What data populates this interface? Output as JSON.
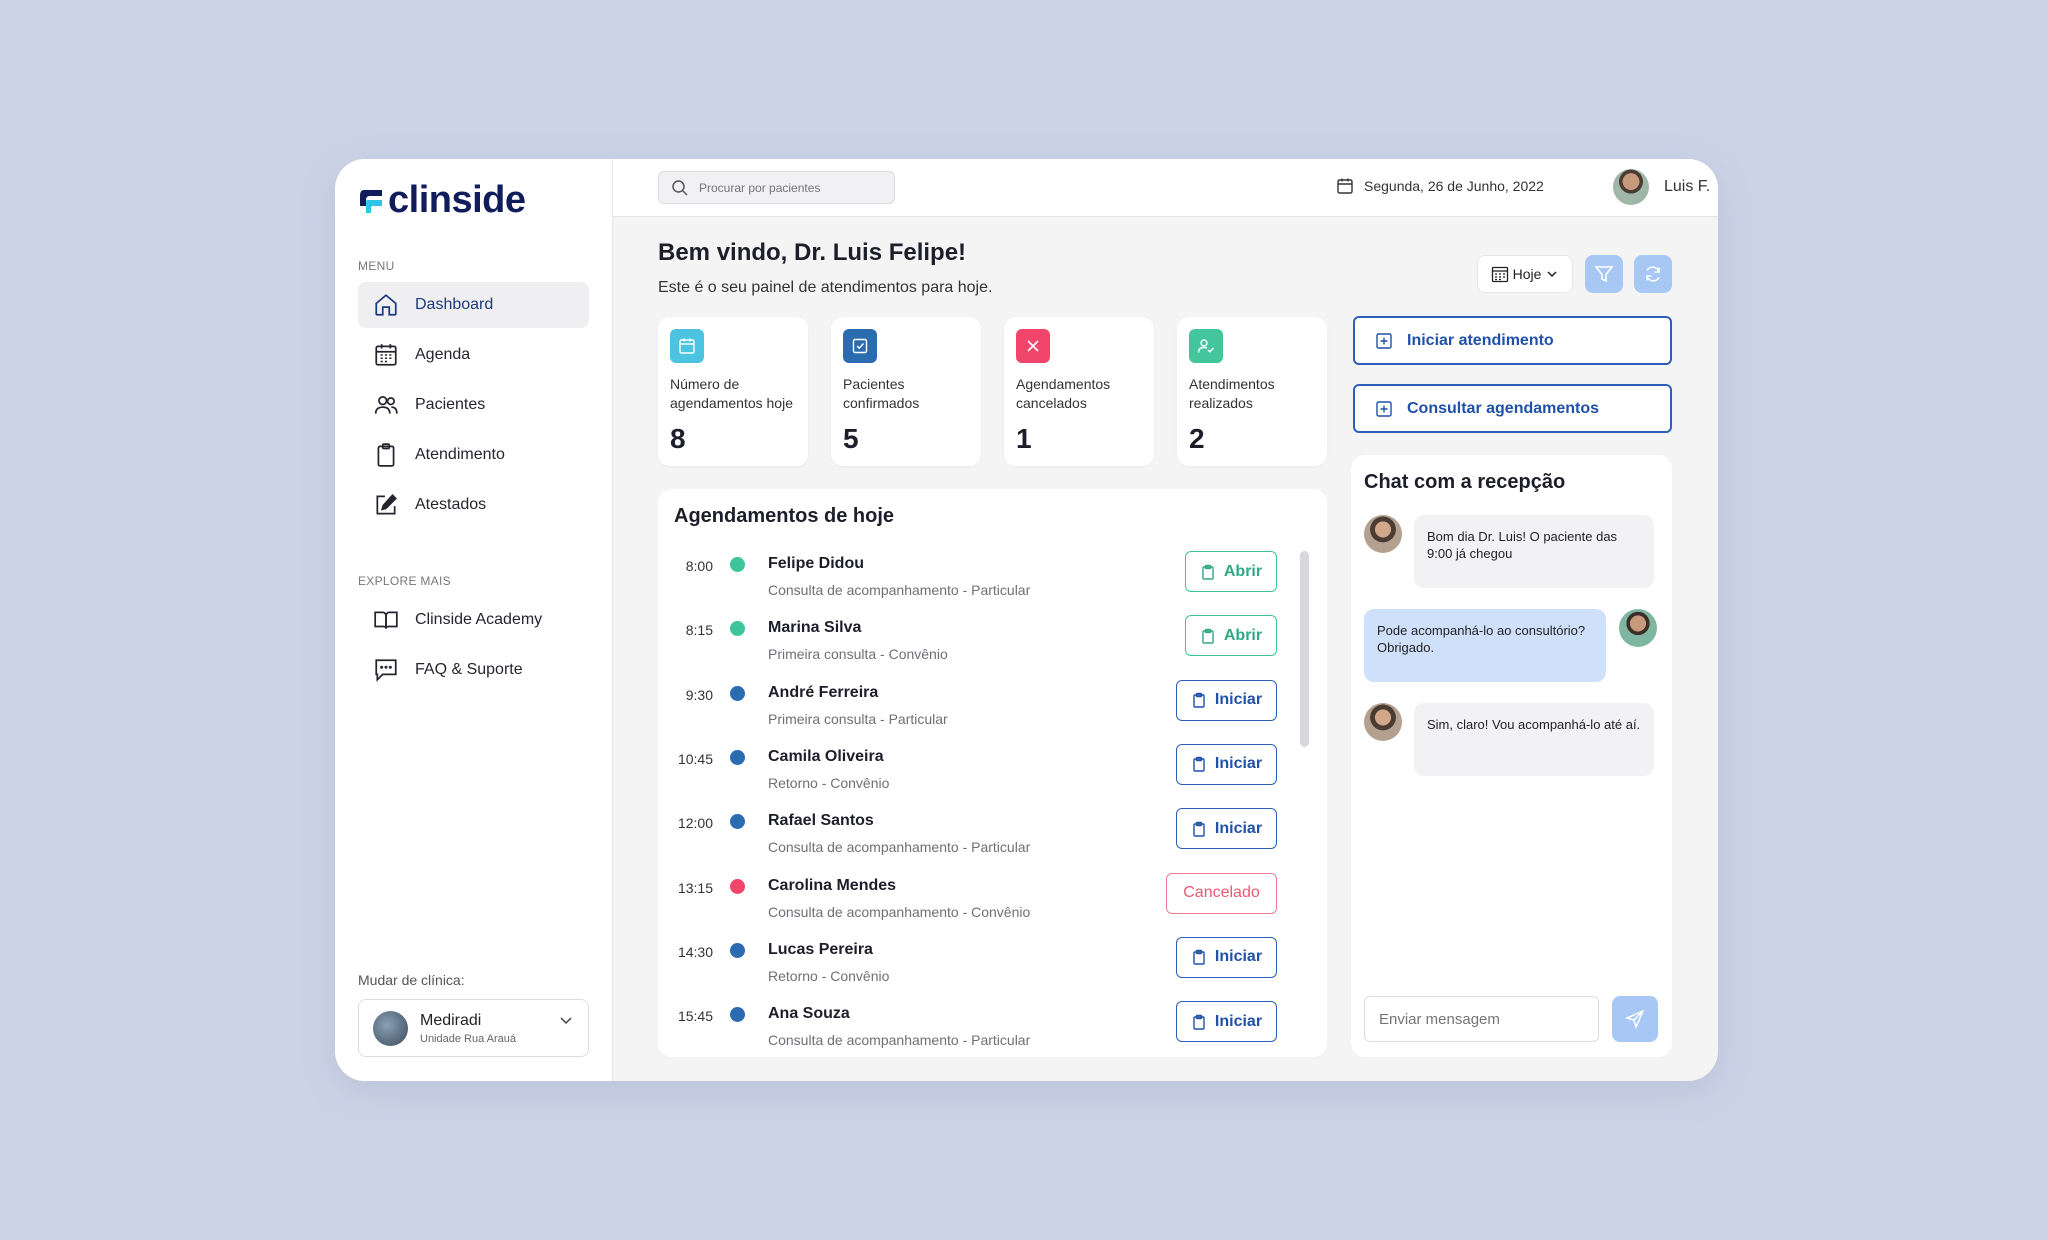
{
  "brand": {
    "name": "clinside"
  },
  "sidebar": {
    "menu_label": "MENU",
    "menu_items": [
      {
        "label": "Dashboard",
        "icon": "home-icon",
        "active": true
      },
      {
        "label": "Agenda",
        "icon": "calendar-grid-icon",
        "active": false
      },
      {
        "label": "Pacientes",
        "icon": "users-icon",
        "active": false
      },
      {
        "label": "Atendimento",
        "icon": "clipboard-icon",
        "active": false
      },
      {
        "label": "Atestados",
        "icon": "edit-icon",
        "active": false
      }
    ],
    "explore_label": "EXPLORE MAIS",
    "explore_items": [
      {
        "label": "Clinside Academy",
        "icon": "book-icon"
      },
      {
        "label": "FAQ & Suporte",
        "icon": "chat-icon"
      }
    ],
    "clinic_label": "Mudar de clínica:",
    "clinic": {
      "name": "Mediradi",
      "unit": "Unidade Rua Arauá"
    }
  },
  "topbar": {
    "search_placeholder": "Procurar por pacientes",
    "date": "Segunda, 26 de Junho, 2022",
    "user_name": "Luis F."
  },
  "header": {
    "welcome": "Bem vindo, Dr. Luis Felipe!",
    "subtitle": "Este é o seu painel de atendimentos para hoje.",
    "period": "Hoje"
  },
  "stats": [
    {
      "label": "Número de agendamentos hoje",
      "value": "8",
      "color": "#4cc3e0",
      "icon": "calendar-icon"
    },
    {
      "label": "Pacientes confirmados",
      "value": "5",
      "color": "#2b6cb0",
      "icon": "check-square-icon"
    },
    {
      "label": "Agendamentos cancelados",
      "value": "1",
      "color": "#f2456b",
      "icon": "x-icon"
    },
    {
      "label": "Atendimentos realizados",
      "value": "2",
      "color": "#43c69b",
      "icon": "user-check-icon"
    }
  ],
  "actions": {
    "start": "Iniciar atendimento",
    "consult": "Consultar agendamentos"
  },
  "appointments": {
    "title": "Agendamentos de hoje",
    "items": [
      {
        "time": "8:00",
        "name": "Felipe Didou",
        "type": "Consulta de acompanhamento - Particular",
        "status": "green",
        "action": "Abrir"
      },
      {
        "time": "8:15",
        "name": "Marina Silva",
        "type": "Primeira consulta - Convênio",
        "status": "green",
        "action": "Abrir"
      },
      {
        "time": "9:30",
        "name": "André Ferreira",
        "type": "Primeira consulta - Particular",
        "status": "blue",
        "action": "Iniciar"
      },
      {
        "time": "10:45",
        "name": "Camila Oliveira",
        "type": "Retorno - Convênio",
        "status": "blue",
        "action": "Iniciar"
      },
      {
        "time": "12:00",
        "name": "Rafael Santos",
        "type": "Consulta de acompanhamento - Particular",
        "status": "blue",
        "action": "Iniciar"
      },
      {
        "time": "13:15",
        "name": "Carolina Mendes",
        "type": "Consulta de acompanhamento - Convênio",
        "status": "red",
        "action": "Cancelado"
      },
      {
        "time": "14:30",
        "name": "Lucas Pereira",
        "type": "Retorno - Convênio",
        "status": "blue",
        "action": "Iniciar"
      },
      {
        "time": "15:45",
        "name": "Ana Souza",
        "type": "Consulta de acompanhamento - Particular",
        "status": "blue",
        "action": "Iniciar"
      }
    ]
  },
  "chat": {
    "title": "Chat com a recepção",
    "messages": [
      {
        "from": "reception",
        "text": "Bom dia Dr. Luis! O paciente das 9:00 já chegou"
      },
      {
        "from": "doctor",
        "text": "Pode acompanhá-lo ao consultório? Obrigado."
      },
      {
        "from": "reception",
        "text": "Sim, claro! Vou acompanhá-lo até aí."
      }
    ],
    "input_placeholder": "Enviar mensagem"
  },
  "colors": {
    "accent": "#2051a8",
    "green": "#3dc49a",
    "blue": "#2b6cb0",
    "red": "#f2456b",
    "light_blue": "#a7c8f5"
  }
}
